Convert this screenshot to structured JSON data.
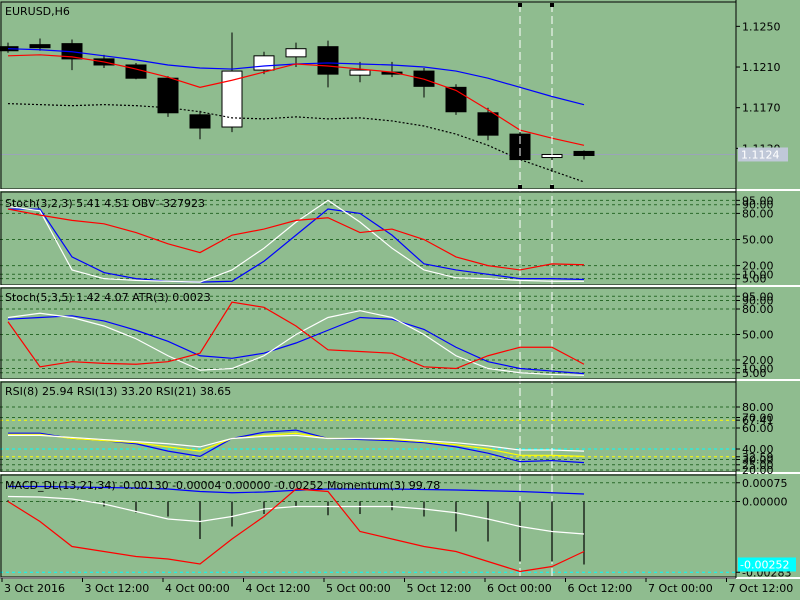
{
  "chart_data": {
    "type": "candlestick",
    "title": "EURUSD,H6",
    "colors": {
      "background": "#8fbc8f",
      "bull_body": "#ffffff",
      "bear_body": "#000000",
      "ma_red": "#ff0000",
      "ma_blue": "#0000ff",
      "signal_white": "#ffffff",
      "signal_yellow": "#ffff00",
      "grid_dash": "#2a6a2a",
      "level_cyan": "#00ffff",
      "price_line": "#9aa4b8"
    },
    "x_labels": [
      "3 Oct 2016",
      "3 Oct 12:00",
      "4 Oct 00:00",
      "4 Oct 12:00",
      "5 Oct 00:00",
      "5 Oct 12:00",
      "6 Oct 00:00",
      "6 Oct 12:00",
      "7 Oct 00:00",
      "7 Oct 12:00"
    ],
    "price_axis": {
      "ylim": [
        1.1093,
        1.127
      ],
      "ticks": [
        "1.1250",
        "1.1210",
        "1.1170",
        "1.1130"
      ],
      "current_price": "1.1124",
      "current_value": 1.1124
    },
    "candles": [
      {
        "o": 1.123,
        "h": 1.1234,
        "l": 1.1224,
        "c": 1.1226
      },
      {
        "o": 1.1232,
        "h": 1.1238,
        "l": 1.1226,
        "c": 1.1229
      },
      {
        "o": 1.1233,
        "h": 1.1237,
        "l": 1.1207,
        "c": 1.1218
      },
      {
        "o": 1.1218,
        "h": 1.1222,
        "l": 1.1209,
        "c": 1.1212
      },
      {
        "o": 1.1212,
        "h": 1.1214,
        "l": 1.1198,
        "c": 1.1199
      },
      {
        "o": 1.1199,
        "h": 1.1201,
        "l": 1.1161,
        "c": 1.1165
      },
      {
        "o": 1.1163,
        "h": 1.1167,
        "l": 1.1139,
        "c": 1.115
      },
      {
        "o": 1.1151,
        "h": 1.1244,
        "l": 1.1146,
        "c": 1.1206
      },
      {
        "o": 1.1207,
        "h": 1.1225,
        "l": 1.1203,
        "c": 1.1221
      },
      {
        "o": 1.122,
        "h": 1.1234,
        "l": 1.121,
        "c": 1.1228
      },
      {
        "o": 1.123,
        "h": 1.1236,
        "l": 1.119,
        "c": 1.1203
      },
      {
        "o": 1.1202,
        "h": 1.1215,
        "l": 1.1195,
        "c": 1.1207
      },
      {
        "o": 1.1205,
        "h": 1.1215,
        "l": 1.12,
        "c": 1.1203
      },
      {
        "o": 1.1206,
        "h": 1.1209,
        "l": 1.118,
        "c": 1.1191
      },
      {
        "o": 1.119,
        "h": 1.1193,
        "l": 1.1163,
        "c": 1.1166
      },
      {
        "o": 1.1165,
        "h": 1.117,
        "l": 1.1138,
        "c": 1.1143
      },
      {
        "o": 1.1144,
        "h": 1.1146,
        "l": 1.112,
        "c": 1.1119
      },
      {
        "o": 1.1121,
        "h": 1.1127,
        "l": 1.1105,
        "c": 1.1124
      },
      {
        "o": 1.1127,
        "h": 1.1128,
        "l": 1.1119,
        "c": 1.1123
      }
    ],
    "ma_red": [
      1.1221,
      1.1222,
      1.122,
      1.1215,
      1.1208,
      1.12,
      1.119,
      1.1197,
      1.1205,
      1.1213,
      1.1211,
      1.1208,
      1.1205,
      1.1198,
      1.1187,
      1.1168,
      1.1148,
      1.114,
      1.1133
    ],
    "ma_blue": [
      1.1228,
      1.1227,
      1.1225,
      1.1221,
      1.1217,
      1.1212,
      1.1209,
      1.1208,
      1.1211,
      1.1213,
      1.1214,
      1.1213,
      1.1212,
      1.121,
      1.1206,
      1.1199,
      1.119,
      1.1181,
      1.1173
    ],
    "ma_dotted": [
      1.1174,
      1.1173,
      1.1172,
      1.1173,
      1.1172,
      1.117,
      1.1166,
      1.116,
      1.1159,
      1.1161,
      1.1159,
      1.116,
      1.1157,
      1.1152,
      1.1144,
      1.1133,
      1.1119,
      1.1108,
      1.1097
    ],
    "vlines_index": [
      16,
      17
    ],
    "subwindows": [
      {
        "label": "Stoch(3,2,3) 5.41 4.51 OBV -327923",
        "ylim": [
          0,
          100
        ],
        "levels": [
          95,
          90,
          80,
          50,
          20,
          10,
          5
        ],
        "ticks": [
          "95.00",
          "90.00",
          "80.00",
          "50.00",
          "20.00",
          "10.00",
          "5.00"
        ],
        "series": [
          {
            "color": "blue",
            "values": [
              85,
              85,
              30,
              12,
              5,
              2,
              1,
              2,
              25,
              55,
              85,
              80,
              55,
              22,
              15,
              10,
              5,
              5,
              4
            ]
          },
          {
            "color": "white",
            "values": [
              88,
              83,
              15,
              5,
              3,
              2,
              1,
              15,
              40,
              70,
              95,
              70,
              40,
              15,
              6,
              5,
              3,
              2,
              2
            ]
          },
          {
            "color": "red",
            "values": [
              85,
              78,
              72,
              68,
              58,
              45,
              35,
              55,
              62,
              72,
              75,
              58,
              62,
              50,
              30,
              20,
              15,
              22,
              21
            ]
          }
        ]
      },
      {
        "label": "Stoch(5,3,5) 1.42 4.07 ATR(3) 0.0023",
        "ylim": [
          0,
          100
        ],
        "levels": [
          95,
          90,
          80,
          50,
          20,
          10,
          5
        ],
        "ticks": [
          "95.00",
          "90.00",
          "80.00",
          "50.00",
          "20.00",
          "10.00",
          "5.00"
        ],
        "series": [
          {
            "color": "blue",
            "values": [
              68,
              70,
              72,
              66,
              55,
              42,
              25,
              22,
              28,
              40,
              55,
              70,
              68,
              56,
              35,
              18,
              10,
              7,
              4
            ]
          },
          {
            "color": "white",
            "values": [
              70,
              75,
              70,
              60,
              45,
              25,
              8,
              10,
              25,
              50,
              70,
              78,
              70,
              50,
              25,
              10,
              5,
              3,
              2
            ]
          },
          {
            "color": "red",
            "values": [
              65,
              12,
              18,
              16,
              15,
              18,
              28,
              88,
              82,
              60,
              32,
              30,
              28,
              12,
              10,
              25,
              35,
              35,
              15
            ]
          }
        ]
      },
      {
        "label": "RSI(8) 25.94 RSI(13) 33.20 RSI(21) 38.65",
        "ylim": [
          20,
          100
        ],
        "levels": [
          80,
          70,
          67.41,
          60,
          40,
          32.59,
          30,
          25,
          20
        ],
        "ticks": [
          "80.00",
          "70.00",
          "67.41",
          "60.00",
          "40.00",
          "32.59",
          "30.00",
          "25.00",
          "20.00"
        ],
        "series": [
          {
            "color": "blue",
            "values": [
              55,
              55,
              50,
              48,
              45,
              38,
              33,
              50,
              56,
              58,
              50,
              49,
              48,
              46,
              42,
              36,
              28,
              29,
              27
            ]
          },
          {
            "color": "yellow",
            "values": [
              54,
              54,
              50,
              48,
              46,
              42,
              38,
              50,
              53,
              55,
              50,
              50,
              49,
              47,
              44,
              40,
              34,
              34,
              33
            ]
          },
          {
            "color": "white",
            "values": [
              53,
              53,
              51,
              49,
              47,
              45,
              42,
              50,
              52,
              53,
              50,
              50,
              50,
              48,
              46,
              43,
              39,
              39,
              38
            ]
          }
        ]
      },
      {
        "label": "MACD_DL(13,21,34) -0.00130 -0.00004 0.00000 -0.00252 Momentum(3) 99.78",
        "ylim": [
          -0.0029,
          0.0009
        ],
        "levels": [
          0.00075,
          0.0,
          -0.00283
        ],
        "ticks": [
          "0.00075",
          "0.00000",
          "-0.00283"
        ],
        "current": "-0.00252",
        "current_value": -0.00252,
        "bars": [
          5e-05,
          2e-05,
          -3e-05,
          -0.0002,
          -0.00045,
          -0.0006,
          -0.0015,
          -0.001,
          -0.0005,
          -0.0002,
          -0.00055,
          -0.0005,
          -0.00035,
          -0.0006,
          -0.0012,
          -0.0016,
          -0.0024,
          -0.0024,
          -0.00252
        ],
        "series": [
          {
            "color": "blue",
            "values": [
              0.0006,
              0.0006,
              0.00058,
              0.00056,
              0.00054,
              0.0005,
              0.0004,
              0.00035,
              0.00038,
              0.00045,
              0.0005,
              0.0005,
              0.0005,
              0.00048,
              0.00046,
              0.00043,
              0.0004,
              0.00035,
              0.0003
            ]
          },
          {
            "color": "white",
            "values": [
              0.0002,
              0.00018,
              0.0001,
              -0.0001,
              -0.0004,
              -0.0007,
              -0.0008,
              -0.0006,
              -0.0003,
              -0.0002,
              -0.0002,
              -0.0002,
              -0.0002,
              -0.0003,
              -0.00045,
              -0.0007,
              -0.001,
              -0.0012,
              -0.0013
            ]
          },
          {
            "color": "red",
            "values": [
              0.0,
              -0.0008,
              -0.0018,
              -0.002,
              -0.0022,
              -0.0023,
              -0.0025,
              -0.0015,
              -0.0006,
              0.0005,
              0.0004,
              -0.0012,
              -0.0015,
              -0.0018,
              -0.002,
              -0.0024,
              -0.0028,
              -0.0026,
              -0.002
            ]
          }
        ]
      }
    ]
  }
}
